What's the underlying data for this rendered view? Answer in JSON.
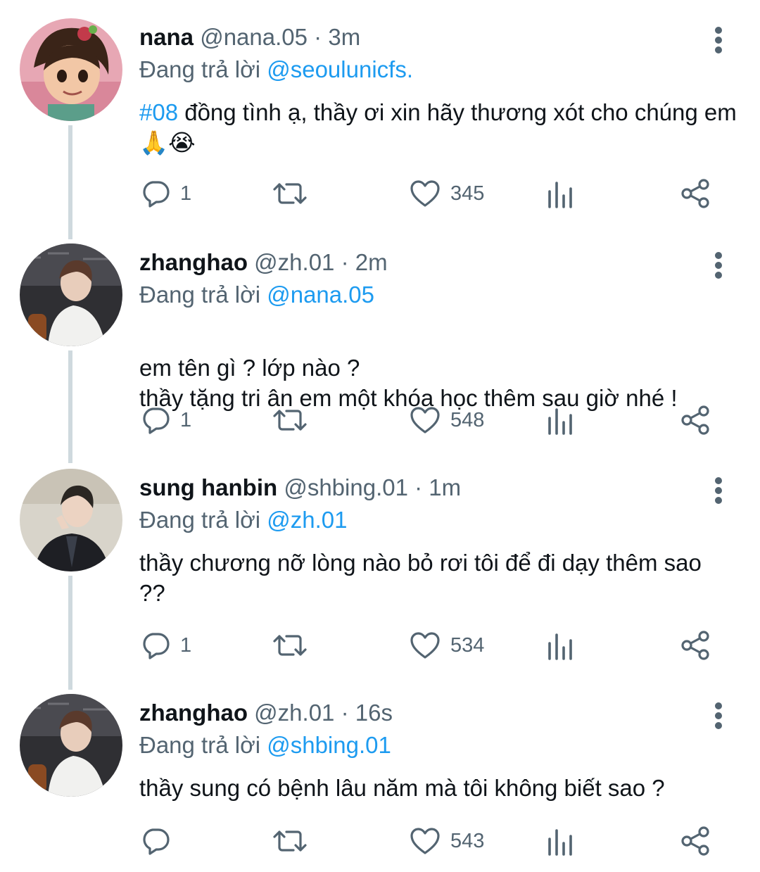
{
  "colors": {
    "accent": "#1d9bf0",
    "muted": "#536471",
    "text": "#0f1419",
    "thread_line": "#cfd9de"
  },
  "icons": {
    "reply": "reply-icon",
    "retweet": "retweet-icon",
    "like": "heart-icon",
    "views": "analytics-icon",
    "share": "share-icon",
    "more": "more-vertical-icon"
  },
  "replying_prefix": "Đang trả lời",
  "tweets": [
    {
      "name": "nana",
      "handle": "@nana.05",
      "time": "3m",
      "reply_to": "@seoulunicfs.",
      "hashtag": "#08",
      "text": " đồng tình ạ, thầy ơi xin hãy thương xót cho chúng em 🙏😭",
      "replies": "1",
      "likes": "345"
    },
    {
      "name": "zhanghao",
      "handle": "@zh.01",
      "time": "2m",
      "reply_to": "@nana.05",
      "hashtag": "",
      "text": "em tên gì ? lớp nào ?\nthầy tặng tri ân em một khóa học thêm sau giờ nhé !",
      "replies": "1",
      "likes": "548"
    },
    {
      "name": "sung hanbin",
      "handle": "@shbing.01",
      "time": "1m",
      "reply_to": "@zh.01",
      "hashtag": "",
      "text": "thầy chương nỡ lòng nào bỏ rơi tôi để đi dạy thêm sao ??",
      "replies": "1",
      "likes": "534"
    },
    {
      "name": "zhanghao",
      "handle": "@zh.01",
      "time": "16s",
      "reply_to": "@shbing.01",
      "hashtag": "",
      "text": "thầy sung có bệnh lâu năm mà tôi không biết sao ?",
      "replies": "",
      "likes": "543"
    }
  ]
}
